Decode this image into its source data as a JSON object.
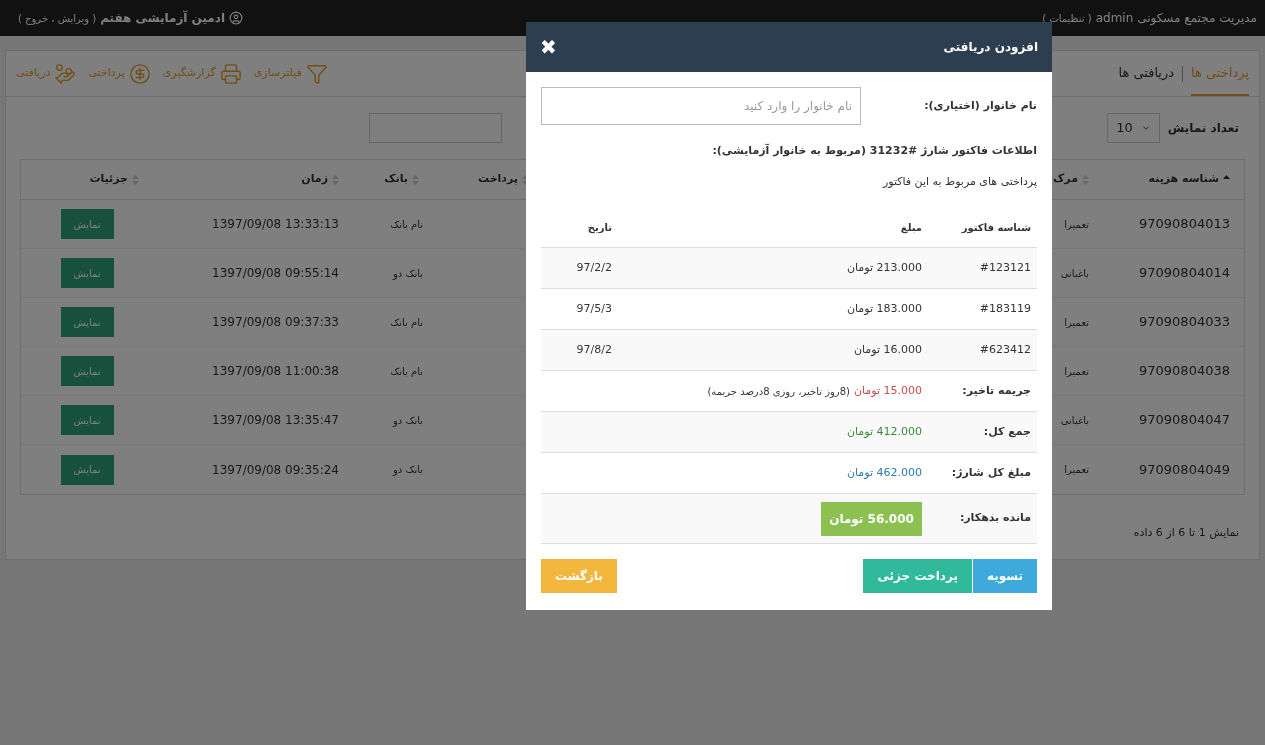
{
  "topbar": {
    "title": "مدیریت مجتمع مسکونی admin",
    "settings_link": "( تنظیمات )",
    "user": "ادمین آزمایشی هفتم",
    "user_links": "( ویرایش ، خروج )"
  },
  "tabs": [
    {
      "label": "پرداختی ها",
      "selected": true
    },
    {
      "label": "دریافتی ها",
      "selected": false
    }
  ],
  "toolbar": [
    {
      "label": "فیلترسازی",
      "kind": "filter"
    },
    {
      "label": "گزارشگیری",
      "kind": "print"
    },
    {
      "label": "پرداختی",
      "kind": "pay"
    },
    {
      "label": "دریافتی",
      "kind": "receive"
    }
  ],
  "page_size": {
    "label": "تعداد نمایش",
    "value": "10"
  },
  "table": {
    "columns": [
      {
        "label": "شناسه هزینه",
        "sorted": true
      },
      {
        "label": "مرک",
        "sorted": false
      },
      {
        "label": "پرداخت",
        "sorted": false
      },
      {
        "label": "بانک",
        "sorted": false
      },
      {
        "label": "زمان",
        "sorted": false
      },
      {
        "label": "جزئیات",
        "sorted": false
      }
    ],
    "rows": [
      {
        "id": "97090804013",
        "category": "تعمیرا",
        "bank": "نام بانک",
        "time": "13:33:13 1397/09/08",
        "action": "نمایش"
      },
      {
        "id": "97090804014",
        "category": "باغبانی",
        "bank": "بانک دو",
        "time": "09:55:14 1397/09/08",
        "action": "نمایش"
      },
      {
        "id": "97090804033",
        "category": "تعمیرا",
        "bank": "نام بانک",
        "time": "09:37:33 1397/09/08",
        "action": "نمایش"
      },
      {
        "id": "97090804038",
        "category": "تعمیرا",
        "bank": "نام بانک",
        "time": "11:00:38 1397/09/08",
        "action": "نمایش"
      },
      {
        "id": "97090804047",
        "category": "باغبانی",
        "bank": "بانک دو",
        "time": "13:35:47 1397/09/08",
        "action": "نمایش"
      },
      {
        "id": "97090804049",
        "category": "تعمیرا",
        "bank": "بانک دو",
        "time": "09:35:24 1397/09/08",
        "action": "نمایش"
      }
    ]
  },
  "footer": "نمایش 1 تا 6 از 6 داده",
  "modal": {
    "title": "افزودن دریافتی",
    "close": "✖",
    "field": {
      "label": "نام خانوار (اختیاری):",
      "placeholder": "نام خانوار را وارد کنید"
    },
    "invoice_heading": "اطلاعات فاکتور شارژ #31232 (مربوط به خانوار آزمایشی):",
    "payments_heading": "پرداختی های مربوط به این فاکتور",
    "payments": {
      "columns": [
        "شناسه فاکتور",
        "مبلغ",
        "تاریخ"
      ],
      "rows": [
        {
          "id": "#123121",
          "amount": "213.000 تومان",
          "date": "97/2/2"
        },
        {
          "id": "#183119",
          "amount": "183.000 تومان",
          "date": "97/5/3"
        },
        {
          "id": "#623412",
          "amount": "16.000 تومان",
          "date": "97/8/2"
        }
      ]
    },
    "summary": [
      {
        "label": "جریمه تاخیر:",
        "amount": "15.000 تومان",
        "note": "(8روز تاخیر، روزی 8درصد جریمه)",
        "kind": "penalty"
      },
      {
        "label": "جمع کل:",
        "amount": "412.000 تومان",
        "kind": "total"
      },
      {
        "label": "مبلغ کل شارژ:",
        "amount": "462.000 تومان",
        "kind": "charge"
      },
      {
        "label": "مانده بدهکار:",
        "amount": "56.000 تومان",
        "kind": "balance"
      }
    ],
    "buttons": [
      {
        "label": "تسویه",
        "kind": "settle"
      },
      {
        "label": "پرداخت جزئی",
        "kind": "partial"
      },
      {
        "label": "بازگشت",
        "kind": "back"
      }
    ]
  }
}
